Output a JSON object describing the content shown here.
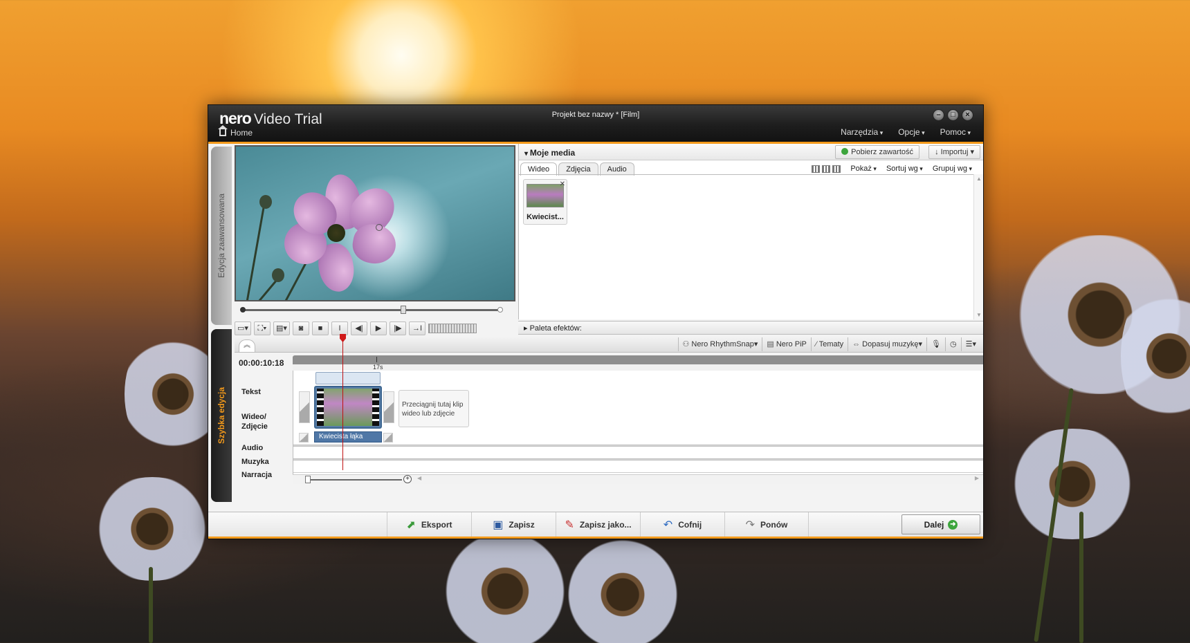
{
  "app": {
    "brand": "nero",
    "product": "Video Trial",
    "doc_title": "Projekt bez nazwy * [Film]",
    "home_label": "Home"
  },
  "menu": [
    "Narzędzia",
    "Opcje",
    "Pomoc"
  ],
  "window_controls": [
    "minimize-icon",
    "maximize-icon",
    "close-icon"
  ],
  "side_tabs": {
    "advanced": "Edycja zaawansowana",
    "quick": "Szybka edycja"
  },
  "media": {
    "title": "Moje media",
    "get_content": "Pobierz zawartość",
    "import": "Importuj",
    "tabs": [
      "Wideo",
      "Zdjęcia",
      "Audio"
    ],
    "show": "Pokaż",
    "sort": "Sortuj wg",
    "group": "Grupuj wg",
    "items": [
      {
        "label": "Kwiecist..."
      }
    ]
  },
  "effects_palette": "Paleta efektów:",
  "timeline_tools": {
    "rhythm": "Nero RhythmSnap",
    "pip": "Nero PiP",
    "themes": "Tematy",
    "fit_music": "Dopasuj muzykę"
  },
  "timeline": {
    "timecode": "00:00:10:18",
    "ruler_label": "17s",
    "tracks": {
      "text": "Tekst",
      "video": "Wideo/ Zdjęcie",
      "audio": "Audio",
      "music": "Muzyka",
      "narration": "Narracja"
    },
    "clip_label": "Kwiecista łąka",
    "drop_hint": "Przeciągnij tutaj klip wideo lub zdjęcie"
  },
  "bottom": {
    "export": "Eksport",
    "save": "Zapisz",
    "save_as": "Zapisz jako...",
    "undo": "Cofnij",
    "redo": "Ponów",
    "next": "Dalej"
  },
  "colors": {
    "accent": "#f39a1c",
    "titlebar": "#1e1e1e",
    "clip": "#4f77a6",
    "playhead": "#c01010"
  }
}
